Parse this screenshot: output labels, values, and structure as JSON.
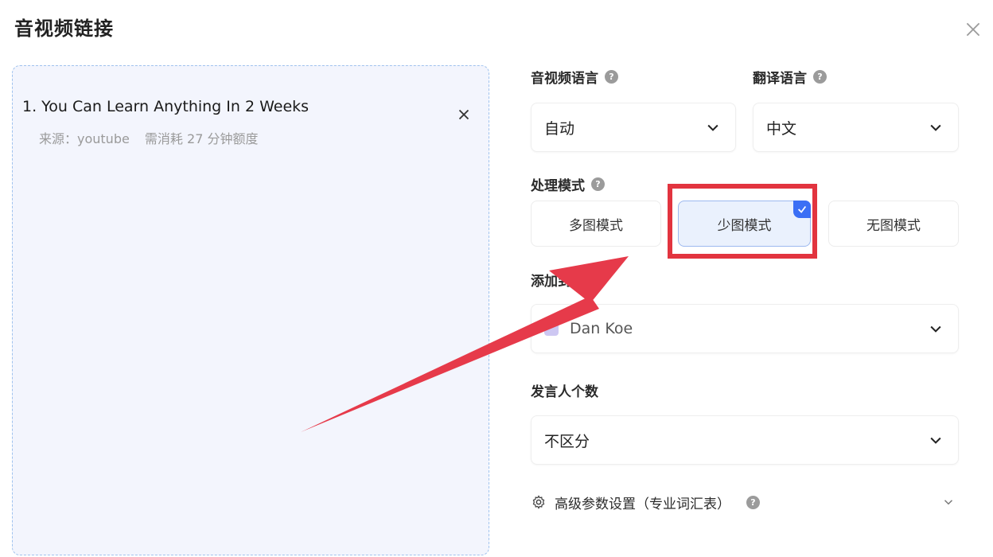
{
  "dialog": {
    "title": "音视频链接"
  },
  "links": [
    {
      "title": "1. You Can Learn Anything In 2 Weeks",
      "source": "来源：youtube",
      "cost": "需消耗 27 分钟额度"
    }
  ],
  "form": {
    "media_language": {
      "label": "音视频语言",
      "value": "自动"
    },
    "translate_language": {
      "label": "翻译语言",
      "value": "中文"
    },
    "mode": {
      "label": "处理模式",
      "options": [
        "多图模式",
        "少图模式",
        "无图模式"
      ],
      "selected": "少图模式"
    },
    "add_to": {
      "label": "添加到",
      "value": "Dan Koe"
    },
    "speakers": {
      "label": "发言人个数",
      "value": "不区分"
    },
    "advanced": {
      "label": "高级参数设置（专业词汇表）"
    }
  },
  "help_glyph": "?",
  "colors": {
    "accent": "#3b6ff5",
    "annotation_red": "#e2343f",
    "panel_bg": "#f3f5fd",
    "panel_border": "#9fc2ee"
  }
}
